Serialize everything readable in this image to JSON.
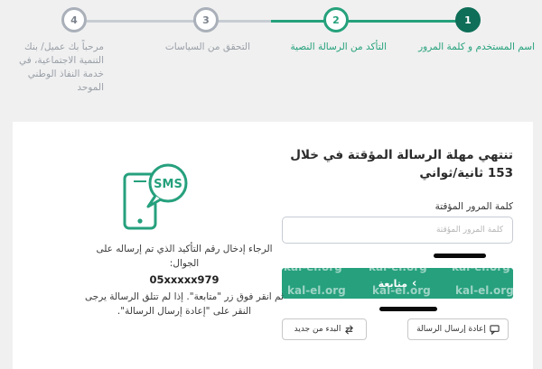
{
  "steps": [
    {
      "number": "1",
      "label": "اسم المستخدم و كلمة المرور"
    },
    {
      "number": "2",
      "label": "التأكد من الرسالة النصية"
    },
    {
      "number": "3",
      "label": "التحقق من السياسات"
    },
    {
      "number": "4",
      "label": "مرحباً بك عميل/ بنك التنمية الاجتماعية، في خدمة النفاذ الوطني الموحد"
    }
  ],
  "form": {
    "title": "تنتهي مهلة الرسالة المؤقتة في خلال 153 ثانية/ثواني",
    "password_label": "كلمة المرور المؤقتة",
    "password_placeholder": "كلمة المرور المؤقتة",
    "continue_label": "متابعة",
    "resend_label": "إعادة إرسال الرسالة",
    "restart_label": "البدء من جديد"
  },
  "info": {
    "sms_text": "SMS",
    "line1": "الرجاء إدخال رقم التأكيد الذي تم إرساله على الجوال:",
    "masked_number": "05xxxxx979",
    "line2": "ثم انقر فوق زر \"متابعة\". إذا لم تتلق الرسالة يرجى النقر على \"إعادة إرسال الرسالة\"."
  },
  "watermark": "kal-el.org",
  "colors": {
    "accent": "#26a07d",
    "accent_dark": "#0e6e57",
    "inactive": "#aab0b9"
  }
}
